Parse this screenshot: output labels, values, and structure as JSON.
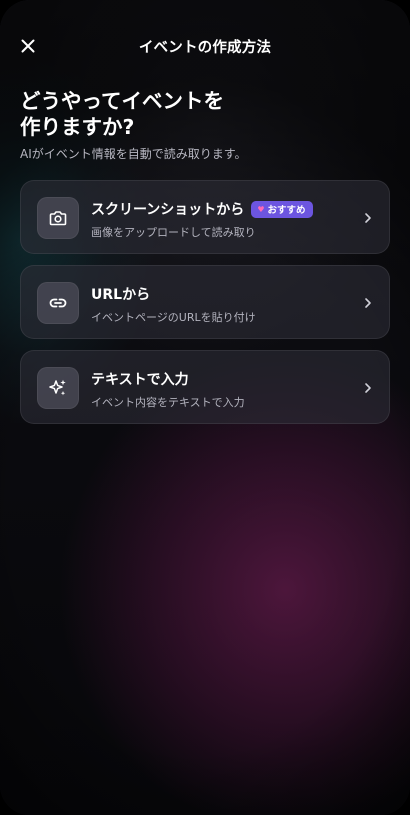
{
  "header": {
    "title": "イベントの作成方法",
    "close_icon": "close-icon"
  },
  "heading": {
    "line1": "どうやってイベントを",
    "line2": "作りますか?"
  },
  "subtitle": "AIがイベント情報を自動で読み取ります。",
  "options": [
    {
      "icon": "camera-icon",
      "title": "スクリーンショットから",
      "badge": "おすすめ",
      "badge_icon": "heart-icon",
      "description": "画像をアップロードして読み取り"
    },
    {
      "icon": "link-icon",
      "title": "URLから",
      "description": "イベントページのURLを貼り付け"
    },
    {
      "icon": "sparkles-icon",
      "title": "テキストで入力",
      "description": "イベント内容をテキストで入力"
    }
  ],
  "colors": {
    "badge_background": "#6c55e0",
    "badge_heart": "#ff69b4",
    "card_background": "#2c2c36",
    "background_glow_magenta": "#761e58",
    "background_glow_teal": "#1e7882"
  }
}
